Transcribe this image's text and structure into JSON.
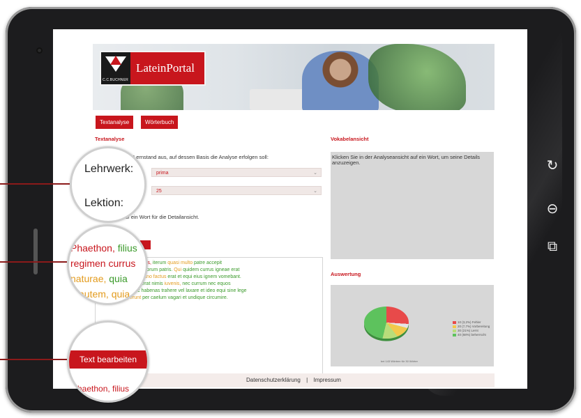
{
  "app": {
    "logo_text": "LateinPortal",
    "logo_sub": "C.C.BUCHNER"
  },
  "tabs": [
    {
      "label": "Textanalyse"
    },
    {
      "label": "Wörterbuch"
    }
  ],
  "textanalyse": {
    "title": "Textanalyse",
    "instruction": "Wählen Sie den Lernstand aus, auf dessen Basis die Analyse erfolgen soll:",
    "lehrwerk_value": "prima",
    "lektion_value": "25",
    "click_hint": "Klicken Sie auf ein Wort für die Detailansicht."
  },
  "latin_text": {
    "line1": [
      {
        "t": "Phaethon, filius ",
        "c": "red"
      },
      {
        "t": "Solis, ",
        "c": "red"
      },
      {
        "t": "iterum ",
        "c": "green"
      },
      {
        "t": "quasi ",
        "c": "orange"
      },
      {
        "t": "multo ",
        "c": "orange"
      },
      {
        "t": "patre ",
        "c": "green"
      },
      {
        "t": "accepit",
        "c": "green"
      }
    ],
    "line2": [
      {
        "t": "regimen currus ",
        "c": "red"
      },
      {
        "t": "equorum ",
        "c": "green"
      },
      {
        "t": "patris. ",
        "c": "green"
      },
      {
        "t": "Qui ",
        "c": "orange"
      },
      {
        "t": "quidem ",
        "c": "green"
      },
      {
        "t": "currus ",
        "c": "green"
      },
      {
        "t": "igneae ",
        "c": "green"
      },
      {
        "t": "erat",
        "c": "green"
      }
    ],
    "line3": [
      {
        "t": "naturae, quia ",
        "c": "orange"
      },
      {
        "t": "Vulcano ",
        "c": "orange"
      },
      {
        "t": "factus ",
        "c": "orange"
      },
      {
        "t": "erat ",
        "c": "green"
      },
      {
        "t": "et equi eius ignem vomebant.",
        "c": "green"
      }
    ],
    "line4": [
      {
        "t": "Phaethon ",
        "c": "orange"
      },
      {
        "t": "autem ",
        "c": "orange"
      },
      {
        "t": "erat ",
        "c": "green"
      },
      {
        "t": "nimis ",
        "c": "green"
      },
      {
        "t": "iuvenis, ",
        "c": "orange"
      },
      {
        "t": "nec currum nec equos",
        "c": "green"
      }
    ],
    "line5": [
      {
        "t": "regere, quia ",
        "c": "green"
      },
      {
        "t": "nec ",
        "c": "green"
      },
      {
        "t": "habenas ",
        "c": "green"
      },
      {
        "t": "trahere vel laxare et ideo equi sine lege",
        "c": "green"
      }
    ],
    "line6": [
      {
        "t": "vagari ",
        "c": "orange"
      },
      {
        "t": "coeperunt ",
        "c": "orange"
      },
      {
        "t": "per caelum vagari et undique circumire.",
        "c": "green"
      }
    ]
  },
  "vokabel": {
    "title": "Vokabelansicht",
    "hint": "Klicken Sie in der Analyseansicht auf ein Wort, um seine Details anzuzeigen."
  },
  "auswertung": {
    "title": "Auswertung",
    "caption": "bei 143 Wörtern für 30 Wörter",
    "legend": [
      {
        "label": "10 (3,2%) Fehler",
        "color": "#e84a4a"
      },
      {
        "label": "20 (7,7%) Vorbereitung",
        "color": "#f2c94c"
      },
      {
        "label": "30 (21%) Lernt",
        "color": "#b8dd7a"
      },
      {
        "label": "40 (68%) beherrscht",
        "color": "#5dc25d"
      }
    ]
  },
  "chart_data": {
    "type": "pie",
    "title": "",
    "labels": [
      "Fehler",
      "Vorbereitung",
      "Lernt",
      "beherrscht"
    ],
    "values": [
      3.2,
      7.7,
      21,
      68
    ]
  },
  "footer": {
    "privacy": "Datenschutzerklärung",
    "separator": "|",
    "imprint": "Impressum"
  },
  "magnifiers": {
    "m1_label1": "Lehrwerk:",
    "m1_label2": "Lektion:",
    "m2_line1a": "Phaethon, ",
    "m2_line1b": "filius",
    "m2_line2": "regimen currus",
    "m2_line3a": "naturae, ",
    "m2_line3b": "quia",
    "m2_line4": "autem, quia",
    "m3_button": "Text bearbeiten",
    "m3_bottom": "Phaethon, filius"
  },
  "colors": {
    "accent": "#c8161d",
    "green": "#3a9a2a",
    "orange": "#e39b1d"
  }
}
